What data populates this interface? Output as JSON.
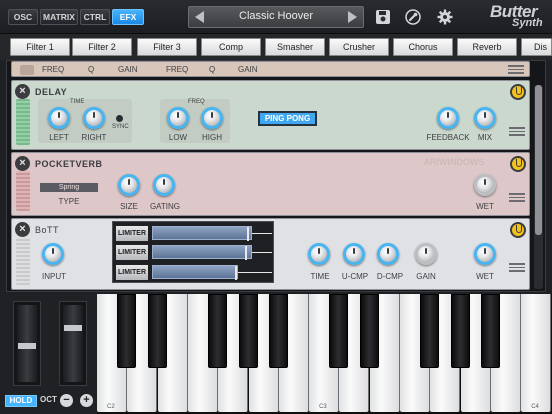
{
  "nav": {
    "osc": "OSC",
    "matrix": "MATRIX",
    "ctrl": "CTRL",
    "efx": "EFX"
  },
  "preset": {
    "name": "Classic Hoover"
  },
  "logo": {
    "line1": "Butter",
    "line2": "Synth"
  },
  "fx_tabs": [
    "Filter 1",
    "Filter 2",
    "Filter 3",
    "Comp",
    "Smasher",
    "Crusher",
    "Chorus",
    "Reverb",
    "Dis"
  ],
  "filter_strip": {
    "labels": [
      "FREQ",
      "Q",
      "GAIN",
      "FREQ",
      "Q",
      "GAIN"
    ]
  },
  "delay": {
    "title": "DELAY",
    "time_label": "TIME",
    "freq_label": "FREQ",
    "sync_label": "SYNC",
    "left": "LEFT",
    "right": "RIGHT",
    "low": "LOW",
    "high": "HIGH",
    "ping_pong": "PING PONG",
    "feedback": "FEEDBACK",
    "mix": "MIX"
  },
  "verb": {
    "title": "POCKETVERB",
    "brand": "ARIWINDOWS",
    "type_value": "Spring",
    "type_label": "TYPE",
    "size": "SIZE",
    "gating": "GATING",
    "wet": "WET"
  },
  "bott": {
    "title": "BoTT",
    "input": "INPUT",
    "limiters": [
      "LIMITER",
      "LIMITER",
      "LIMITER"
    ],
    "time": "TIME",
    "ucmp": "U-CMP",
    "dcmp": "D-CMP",
    "gain": "GAIN",
    "wet": "WET"
  },
  "keyboard": {
    "hold": "HOLD",
    "oct": "OCT",
    "minus": "−",
    "plus": "+",
    "labels": [
      "C2",
      "C3",
      "C4"
    ]
  },
  "colors": {
    "accent": "#45b4ff",
    "power": "#f2c11a"
  }
}
